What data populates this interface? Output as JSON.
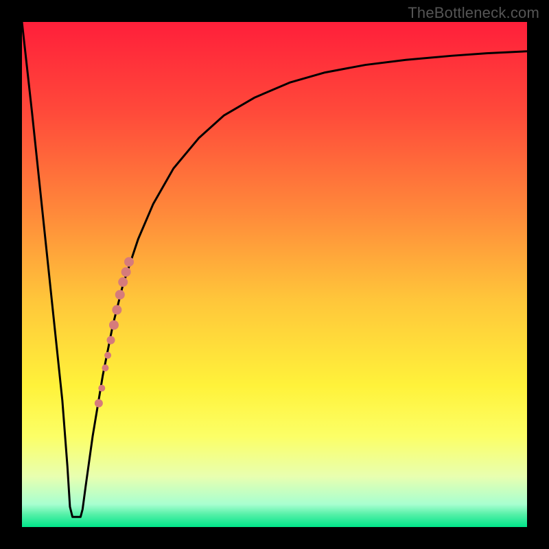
{
  "watermark": "TheBottleneck.com",
  "chart_data": {
    "type": "line",
    "title": "",
    "xlabel": "",
    "ylabel": "",
    "xlim": [
      0,
      100
    ],
    "ylim": [
      0,
      100
    ],
    "grid": false,
    "legend": false,
    "background_gradient": {
      "stops": [
        {
          "pos": 0.0,
          "color": "#ff1f3a"
        },
        {
          "pos": 0.18,
          "color": "#ff4a3a"
        },
        {
          "pos": 0.38,
          "color": "#ff8a3a"
        },
        {
          "pos": 0.55,
          "color": "#ffc63a"
        },
        {
          "pos": 0.72,
          "color": "#fff23a"
        },
        {
          "pos": 0.82,
          "color": "#fcff66"
        },
        {
          "pos": 0.9,
          "color": "#e8ffb0"
        },
        {
          "pos": 0.955,
          "color": "#a8ffd0"
        },
        {
          "pos": 0.975,
          "color": "#55f0a8"
        },
        {
          "pos": 1.0,
          "color": "#00e58a"
        }
      ]
    },
    "curve": {
      "comment": "Bottleneck-percent style curve. x in [0,100], y in [0,100]; 0 = bottom (good/green).",
      "points": [
        [
          0.0,
          100.0
        ],
        [
          2.0,
          82.0
        ],
        [
          4.0,
          63.0
        ],
        [
          6.0,
          44.0
        ],
        [
          8.0,
          25.0
        ],
        [
          9.0,
          12.0
        ],
        [
          9.5,
          4.0
        ],
        [
          10.0,
          2.0
        ],
        [
          11.0,
          2.0
        ],
        [
          11.6,
          2.0
        ],
        [
          12.0,
          3.5
        ],
        [
          12.6,
          8.0
        ],
        [
          14.0,
          18.0
        ],
        [
          16.0,
          30.0
        ],
        [
          18.0,
          40.0
        ],
        [
          20.0,
          48.0
        ],
        [
          23.0,
          57.0
        ],
        [
          26.0,
          64.0
        ],
        [
          30.0,
          71.0
        ],
        [
          35.0,
          77.0
        ],
        [
          40.0,
          81.5
        ],
        [
          46.0,
          85.0
        ],
        [
          53.0,
          88.0
        ],
        [
          60.0,
          90.0
        ],
        [
          68.0,
          91.5
        ],
        [
          76.0,
          92.5
        ],
        [
          85.0,
          93.3
        ],
        [
          92.0,
          93.8
        ],
        [
          100.0,
          94.2
        ]
      ]
    },
    "highlight_points": {
      "color": "#d67b7b",
      "points": [
        {
          "x": 15.2,
          "y": 24.5,
          "r": 6
        },
        {
          "x": 15.8,
          "y": 27.5,
          "r": 5
        },
        {
          "x": 16.5,
          "y": 31.5,
          "r": 5
        },
        {
          "x": 17.0,
          "y": 34.0,
          "r": 5
        },
        {
          "x": 17.6,
          "y": 37.0,
          "r": 6
        },
        {
          "x": 18.2,
          "y": 40.0,
          "r": 7
        },
        {
          "x": 18.8,
          "y": 43.0,
          "r": 7
        },
        {
          "x": 19.4,
          "y": 46.0,
          "r": 7
        },
        {
          "x": 20.0,
          "y": 48.5,
          "r": 7
        },
        {
          "x": 20.6,
          "y": 50.5,
          "r": 7
        },
        {
          "x": 21.2,
          "y": 52.5,
          "r": 7
        }
      ]
    }
  }
}
